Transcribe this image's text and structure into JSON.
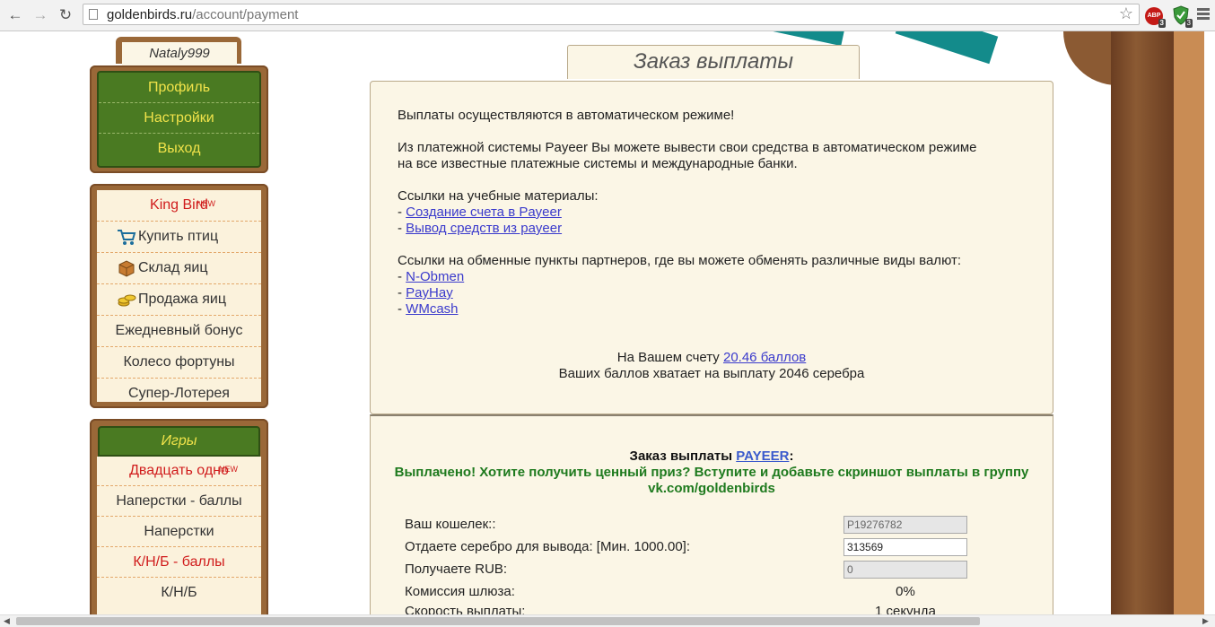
{
  "browser": {
    "url_host": "goldenbirds.ru",
    "url_path": "/account/payment",
    "abp_label": "ABP",
    "abp_badge": "3",
    "shield_badge": "3"
  },
  "user": {
    "name": "Nataly999"
  },
  "account_menu": [
    "Профиль",
    "Настройки",
    "Выход"
  ],
  "shop_menu": [
    {
      "label": "King Bird",
      "new": "NEW"
    },
    {
      "label": "Купить птиц",
      "icon": "cart-icon"
    },
    {
      "label": "Склад яиц",
      "icon": "box-icon"
    },
    {
      "label": "Продажа яиц",
      "icon": "coins-icon"
    },
    {
      "label": "Ежедневный бонус"
    },
    {
      "label": "Колесо фортуны"
    },
    {
      "label": "Супер-Лотерея"
    }
  ],
  "games": {
    "header": "Игры",
    "items": [
      {
        "label": "Двадцать одно",
        "new": "NEW"
      },
      {
        "label": "Наперстки - баллы"
      },
      {
        "label": "Наперстки"
      },
      {
        "label": "К/Н/Б - баллы"
      },
      {
        "label": "К/Н/Б"
      }
    ]
  },
  "main": {
    "title": "Заказ выплаты",
    "auto_line": "Выплаты осуществляются в автоматическом режиме!",
    "payeer_line1": "Из платежной системы Payeer Вы можете вывести свои средства в автоматическом режиме",
    "payeer_line2": "на все известные платежные системы и международные банки.",
    "study_header": "Ссылки на учебные материалы:",
    "study_links": [
      "Создание счета в Payeer",
      "Вывод средств из payeer"
    ],
    "exchange_header": "Ссылки на обменные пункты партнеров, где вы можете обменять различные виды валют:",
    "exchange_links": [
      "N-Obmen",
      "PayHay",
      "WMcash"
    ],
    "dash": "- ",
    "balance_prefix": "На Вашем счету ",
    "balance_link": "20.46 баллов",
    "balance_enough": "Ваших баллов хватает на выплату 2046 серебра"
  },
  "order": {
    "title_prefix": "Заказ выплаты ",
    "title_system": "PAYEER",
    "title_suffix": ":",
    "paid_message": "Выплачено! Хотите получить ценный приз? Вступите и добавьте скриншот выплаты в группу vk.com/goldenbirds",
    "wallet_label": "Ваш кошелек::",
    "wallet_value": "P19276782",
    "give_label": "Отдаете серебро для вывода: [Мин. 1000.00]:",
    "give_value": "313569",
    "receive_label": "Получаете RUB:",
    "receive_value": "0",
    "fee_label": "Комиссия шлюза:",
    "fee_value": "0%",
    "speed_label": "Скорость выплаты:",
    "speed_value": "1 секунда"
  }
}
